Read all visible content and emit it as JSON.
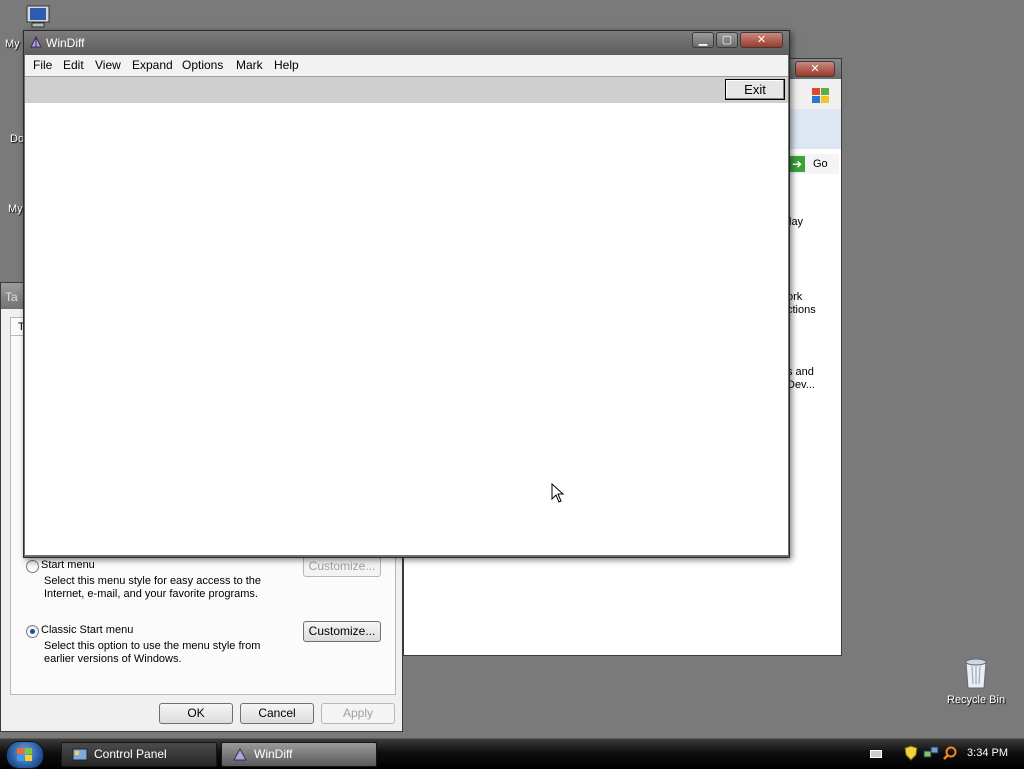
{
  "desktop": {
    "icons": [
      {
        "label": "My",
        "icon": "computer-icon"
      },
      {
        "label": "Do",
        "icon": "documents-icon"
      },
      {
        "label": "My",
        "icon": "network-icon"
      },
      {
        "label": "Recycle Bin",
        "icon": "recycle-bin-icon"
      }
    ]
  },
  "background_window": {
    "go_label": "Go",
    "items": [
      "lay",
      "ork",
      "ctions",
      "s and",
      "Dev..."
    ]
  },
  "taskbar_dialog": {
    "title_fragment": "Ta",
    "tab_fragment": "T",
    "start_menu_label": "Start menu",
    "start_menu_desc_1": "Select this menu style for easy access to the",
    "start_menu_desc_2": "Internet, e-mail, and your favorite programs.",
    "classic_label": "Classic Start menu",
    "classic_desc_1": "Select this option to use the menu style from",
    "classic_desc_2": "earlier versions of Windows.",
    "customize_label": "Customize...",
    "ok_label": "OK",
    "cancel_label": "Cancel",
    "apply_label": "Apply"
  },
  "windiff": {
    "title": "WinDiff",
    "menu": [
      "File",
      "Edit",
      "View",
      "Expand",
      "Options",
      "Mark",
      "Help"
    ],
    "exit_label": "Exit"
  },
  "taskbar": {
    "buttons": [
      {
        "label": "Control Panel",
        "icon": "control-panel-icon"
      },
      {
        "label": "WinDiff",
        "icon": "windiff-icon"
      }
    ],
    "clock": "3:34 PM"
  }
}
